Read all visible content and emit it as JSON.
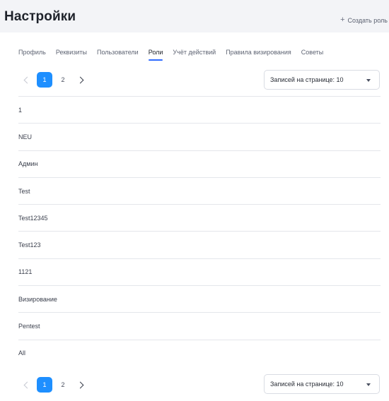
{
  "header": {
    "title": "Настройки",
    "create_role_label": "Создать роль"
  },
  "tabs": [
    {
      "label": "Профиль"
    },
    {
      "label": "Реквизиты"
    },
    {
      "label": "Пользователи"
    },
    {
      "label": "Роли",
      "active": true
    },
    {
      "label": "Учёт действий"
    },
    {
      "label": "Правила визирования"
    },
    {
      "label": "Советы"
    }
  ],
  "pagination": {
    "pages": [
      "1",
      "2"
    ],
    "current": "1",
    "per_page_label": "Записей на странице: 10"
  },
  "roles": [
    "1",
    "NEU",
    "Админ",
    "Test",
    "Test12345",
    "Test123",
    "1121",
    "Визирование",
    "Pentest",
    "All"
  ],
  "colors": {
    "accent": "#1e8fff",
    "tab_underline": "#2f6bff",
    "header_bg": "#f3f4f7",
    "divider": "#e4e6eb"
  }
}
